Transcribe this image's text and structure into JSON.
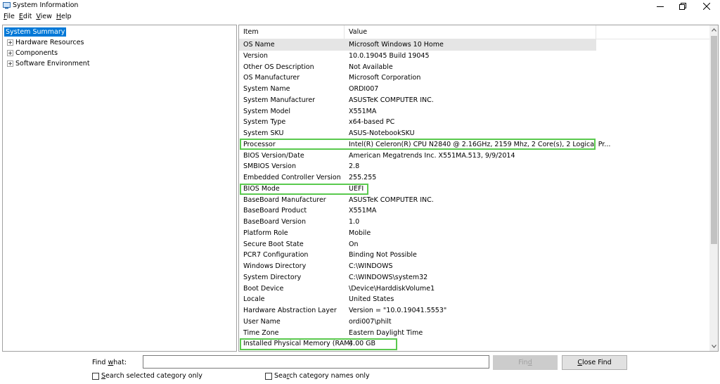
{
  "window": {
    "title": "System Information"
  },
  "menu": [
    {
      "accel": "F",
      "rest": "ile"
    },
    {
      "accel": "E",
      "rest": "dit"
    },
    {
      "accel": "V",
      "rest": "iew"
    },
    {
      "accel": "H",
      "rest": "elp"
    }
  ],
  "tree": {
    "selected": "System Summary",
    "children": [
      "Hardware Resources",
      "Components",
      "Software Environment"
    ]
  },
  "list": {
    "columns": {
      "item": "Item",
      "value": "Value"
    },
    "rows": [
      {
        "item": "OS Name",
        "value": "Microsoft Windows 10 Home"
      },
      {
        "item": "Version",
        "value": "10.0.19045 Build 19045"
      },
      {
        "item": "Other OS Description",
        "value": "Not Available"
      },
      {
        "item": "OS Manufacturer",
        "value": "Microsoft Corporation"
      },
      {
        "item": "System Name",
        "value": "ORDI007"
      },
      {
        "item": "System Manufacturer",
        "value": "ASUSTeK COMPUTER INC."
      },
      {
        "item": "System Model",
        "value": "X551MA"
      },
      {
        "item": "System Type",
        "value": "x64-based PC"
      },
      {
        "item": "System SKU",
        "value": "ASUS-NotebookSKU"
      },
      {
        "item": "Processor",
        "value": "Intel(R) Celeron(R) CPU  N2840  @ 2.16GHz, 2159 Mhz, 2 Core(s), 2 Logical Pr..."
      },
      {
        "item": "BIOS Version/Date",
        "value": "American Megatrends Inc. X551MA.513, 9/9/2014"
      },
      {
        "item": "SMBIOS Version",
        "value": "2.8"
      },
      {
        "item": "Embedded Controller Version",
        "value": "255.255"
      },
      {
        "item": "BIOS Mode",
        "value": "UEFI"
      },
      {
        "item": "BaseBoard Manufacturer",
        "value": "ASUSTeK COMPUTER INC."
      },
      {
        "item": "BaseBoard Product",
        "value": "X551MA"
      },
      {
        "item": "BaseBoard Version",
        "value": "1.0"
      },
      {
        "item": "Platform Role",
        "value": "Mobile"
      },
      {
        "item": "Secure Boot State",
        "value": "On"
      },
      {
        "item": "PCR7 Configuration",
        "value": "Binding Not Possible"
      },
      {
        "item": "Windows Directory",
        "value": "C:\\WINDOWS"
      },
      {
        "item": "System Directory",
        "value": "C:\\WINDOWS\\system32"
      },
      {
        "item": "Boot Device",
        "value": "\\Device\\HarddiskVolume1"
      },
      {
        "item": "Locale",
        "value": "United States"
      },
      {
        "item": "Hardware Abstraction Layer",
        "value": "Version = \"10.0.19041.5553\""
      },
      {
        "item": "User Name",
        "value": "ordi007\\philt"
      },
      {
        "item": "Time Zone",
        "value": "Eastern Daylight Time"
      },
      {
        "item": "Installed Physical Memory (RAM)",
        "value": "4.00 GB"
      }
    ]
  },
  "find": {
    "label_pre": "Find ",
    "label_accel": "w",
    "label_post": "hat:",
    "value": "",
    "find_pre": "Fin",
    "find_accel": "d",
    "close_accel": "C",
    "close_post": "lose Find",
    "search_selected_accel": "S",
    "search_selected_post": "earch selected category only",
    "search_names_pre": "Sea",
    "search_names_accel": "r",
    "search_names_post": "ch category names only"
  },
  "colors": {
    "selection": "#0078d7",
    "highlight_border": "#5ac94e"
  },
  "icons": {
    "app": "system-information-icon",
    "minimize": "minimize-icon",
    "maximize": "restore-icon",
    "close": "close-icon"
  }
}
